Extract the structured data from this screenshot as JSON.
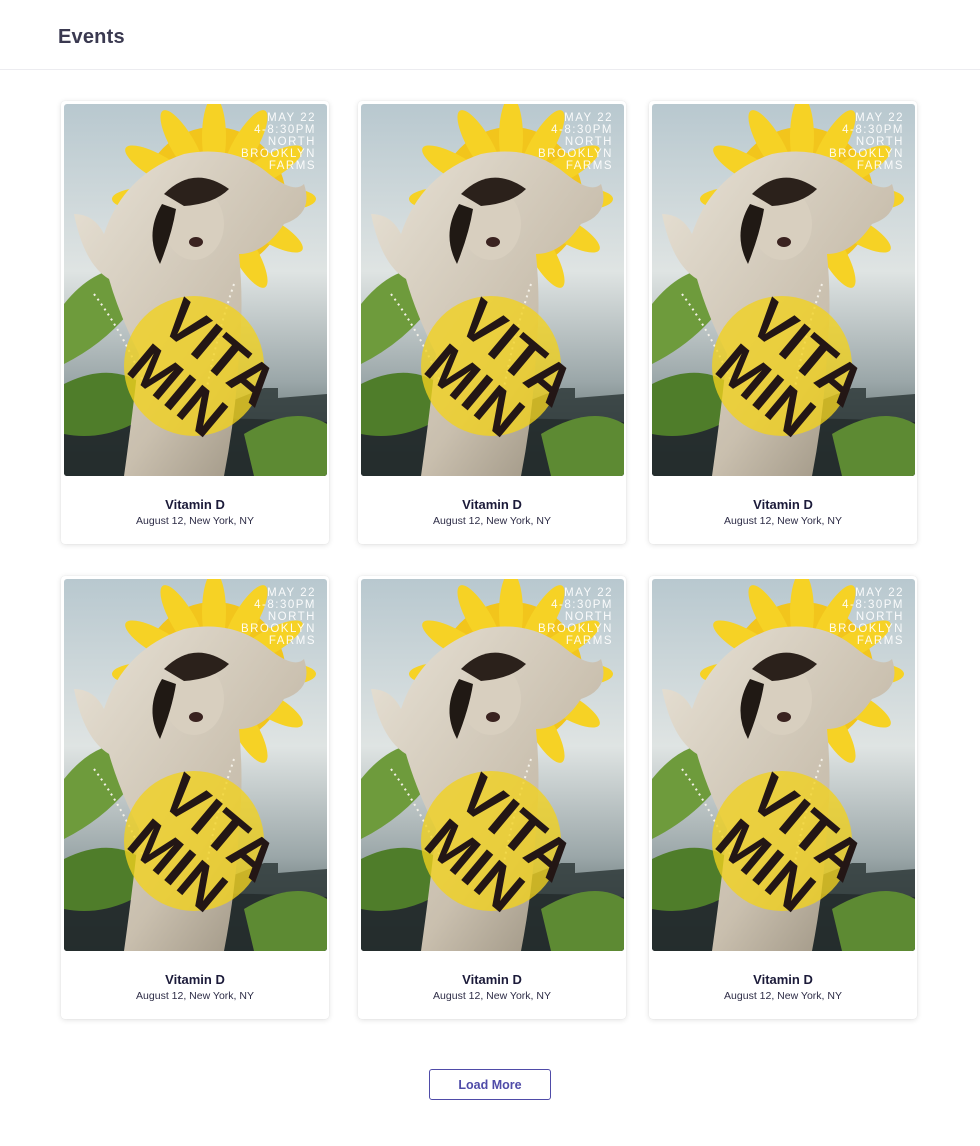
{
  "header": {
    "title": "Events"
  },
  "events": [
    {
      "title": "Vitamin D",
      "subtitle": "August 12, New York, NY",
      "poster": {
        "date_line": "MAY 22",
        "time_line": "4-8:30PM",
        "venue_line1": "NORTH",
        "venue_line2": "BROOKLYN",
        "venue_line3": "FARMS",
        "word_top": "VITA",
        "word_bottom": "MIN"
      }
    },
    {
      "title": "Vitamin D",
      "subtitle": "August 12, New York, NY",
      "poster": {
        "date_line": "MAY 22",
        "time_line": "4-8:30PM",
        "venue_line1": "NORTH",
        "venue_line2": "BROOKLYN",
        "venue_line3": "FARMS",
        "word_top": "VITA",
        "word_bottom": "MIN"
      }
    },
    {
      "title": "Vitamin D",
      "subtitle": "August 12, New York, NY",
      "poster": {
        "date_line": "MAY 22",
        "time_line": "4-8:30PM",
        "venue_line1": "NORTH",
        "venue_line2": "BROOKLYN",
        "venue_line3": "FARMS",
        "word_top": "VITA",
        "word_bottom": "MIN"
      }
    },
    {
      "title": "Vitamin D",
      "subtitle": "August 12, New York, NY",
      "poster": {
        "date_line": "MAY 22",
        "time_line": "4-8:30PM",
        "venue_line1": "NORTH",
        "venue_line2": "BROOKLYN",
        "venue_line3": "FARMS",
        "word_top": "VITA",
        "word_bottom": "MIN"
      }
    },
    {
      "title": "Vitamin D",
      "subtitle": "August 12, New York, NY",
      "poster": {
        "date_line": "MAY 22",
        "time_line": "4-8:30PM",
        "venue_line1": "NORTH",
        "venue_line2": "BROOKLYN",
        "venue_line3": "FARMS",
        "word_top": "VITA",
        "word_bottom": "MIN"
      }
    },
    {
      "title": "Vitamin D",
      "subtitle": "August 12, New York, NY",
      "poster": {
        "date_line": "MAY 22",
        "time_line": "4-8:30PM",
        "venue_line1": "NORTH",
        "venue_line2": "BROOKLYN",
        "venue_line3": "FARMS",
        "word_top": "VITA",
        "word_bottom": "MIN"
      }
    }
  ],
  "load_more": {
    "label": "Load More"
  },
  "colors": {
    "accent": "#4f4ba8",
    "title_text": "#3a3950",
    "poster_yellow": "#f2d21e"
  }
}
